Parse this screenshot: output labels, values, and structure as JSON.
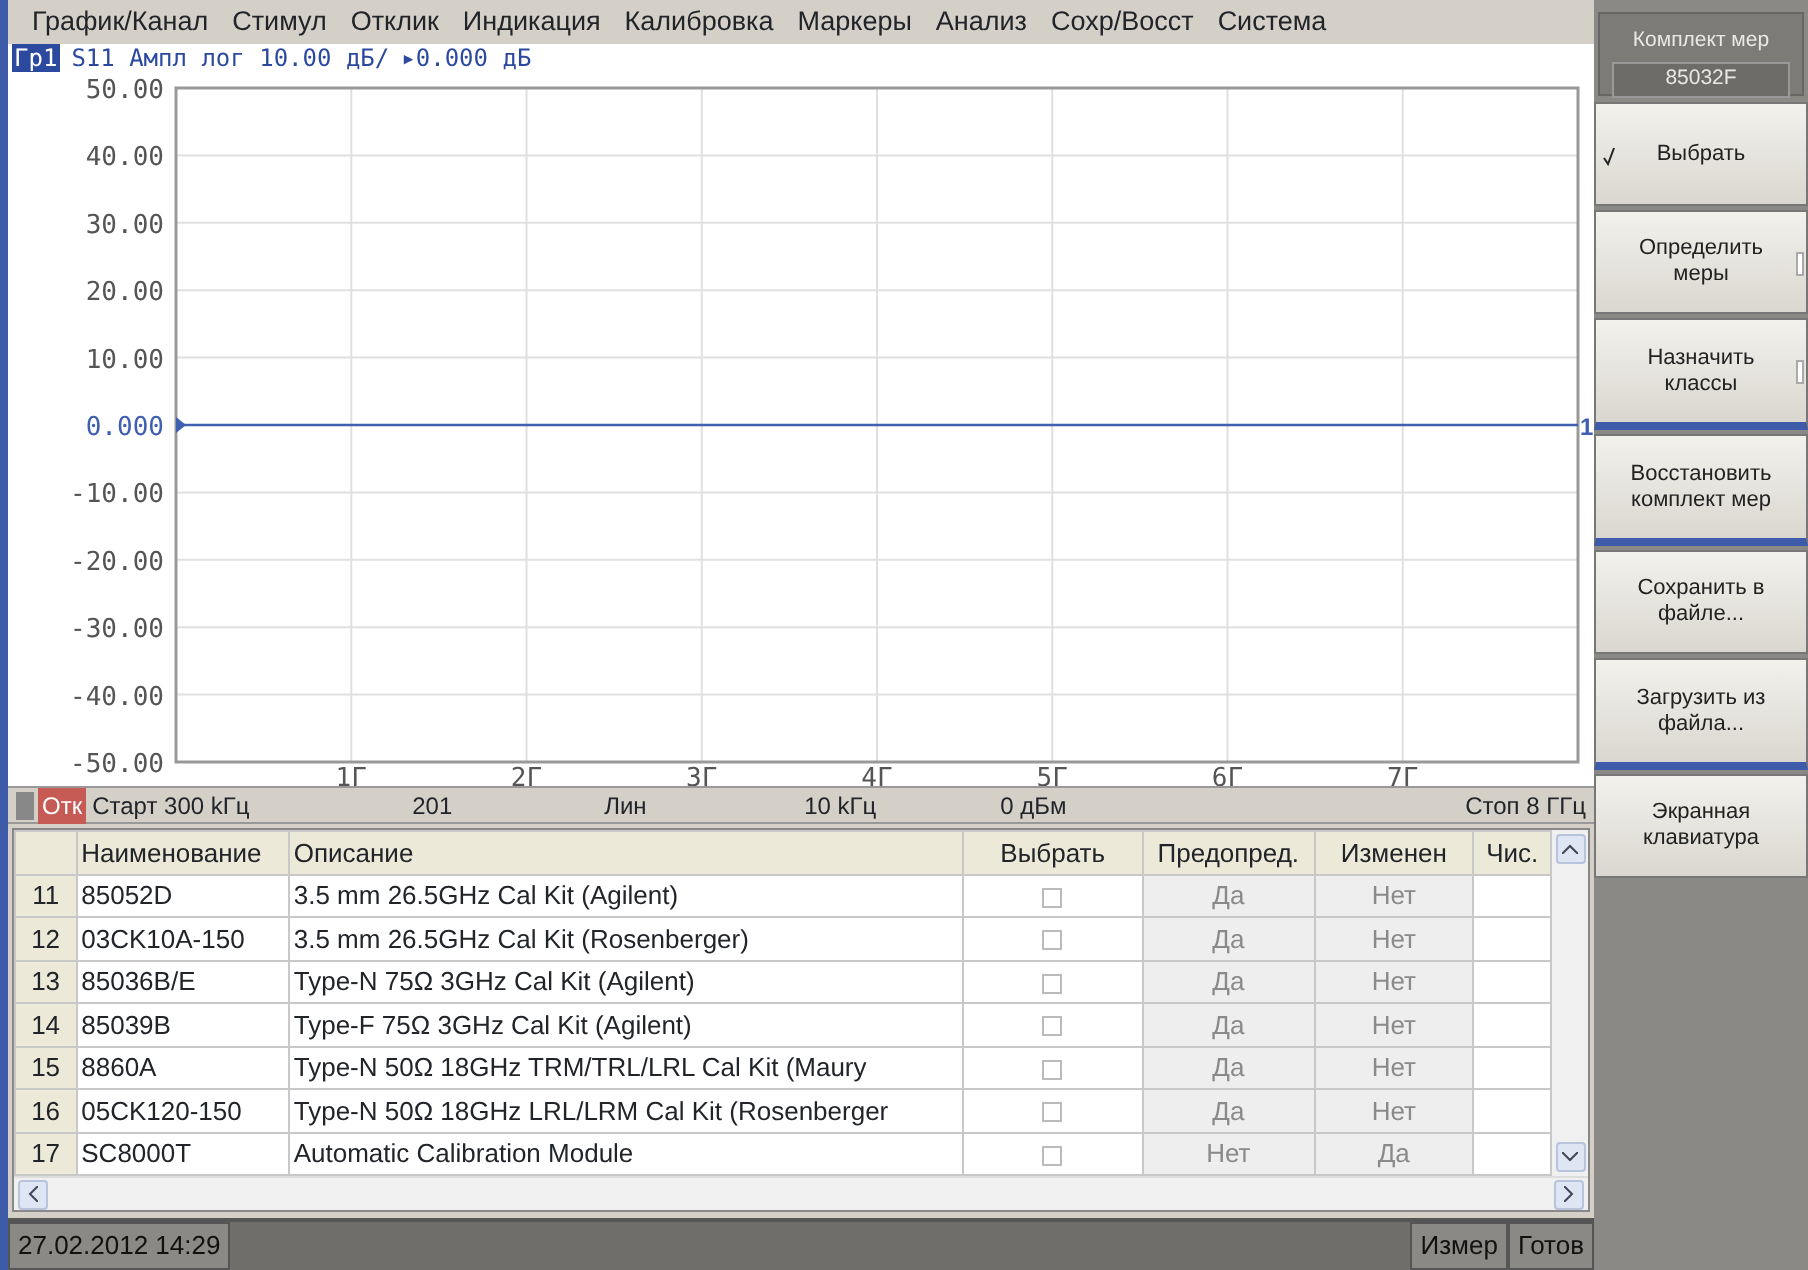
{
  "menu": [
    {
      "label": "График/Канал"
    },
    {
      "label": "Стимул"
    },
    {
      "label": "Отклик"
    },
    {
      "label": "Индикация"
    },
    {
      "label": "Калибровка"
    },
    {
      "label": "Маркеры"
    },
    {
      "label": "Анализ"
    },
    {
      "label": "Сохр/Восст"
    },
    {
      "label": "Система"
    }
  ],
  "trace": {
    "tag": "Гр1",
    "text": "S11 Ампл лог 10.00 дБ/",
    "reference": "▸0.000 дБ",
    "end_label": "1",
    "chart_data": {
      "type": "line",
      "x": [
        0,
        8
      ],
      "grid": true,
      "series": [
        {
          "color": "#3f5fb0",
          "values": [
            0,
            0
          ]
        }
      ],
      "xlim": [
        0,
        8
      ],
      "ylim": [
        -50,
        50
      ],
      "xticks": [
        {
          "value": 1,
          "label": "1Г"
        },
        {
          "value": 2,
          "label": "2Г"
        },
        {
          "value": 3,
          "label": "3Г"
        },
        {
          "value": 4,
          "label": "4Г"
        },
        {
          "value": 5,
          "label": "5Г"
        },
        {
          "value": 6,
          "label": "6Г"
        },
        {
          "value": 7,
          "label": "7Г"
        }
      ],
      "yticks": [
        {
          "value": 50,
          "label": "50.00"
        },
        {
          "value": 40,
          "label": "40.00"
        },
        {
          "value": 30,
          "label": "30.00"
        },
        {
          "value": 20,
          "label": "20.00"
        },
        {
          "value": 10,
          "label": "10.00"
        },
        {
          "value": 0,
          "label": "0.000"
        },
        {
          "value": -10,
          "label": "-10.00"
        },
        {
          "value": -20,
          "label": "-20.00"
        },
        {
          "value": -30,
          "label": "-30.00"
        },
        {
          "value": -40,
          "label": "-40.00"
        },
        {
          "value": -50,
          "label": "-50.00"
        }
      ]
    }
  },
  "channel_bar": {
    "state": "Отк",
    "start": "Старт 300 kГц",
    "points": "201",
    "sweep": "Лин",
    "ifbw": "10 kГц",
    "power": "0 дБм",
    "stop": "Стоп 8 ГГц"
  },
  "table": {
    "columns": [
      "",
      "Наименование",
      "Описание",
      "Выбрать",
      "Предопред.",
      "Изменен",
      "Чис."
    ],
    "rows": [
      {
        "number": "11",
        "name": "85052D",
        "description": "3.5 mm 26.5GHz Cal Kit (Agilent)",
        "checked": false,
        "predefined": "Да",
        "changed": "Нет"
      },
      {
        "number": "12",
        "name": "03CK10A-150",
        "description": "3.5 mm 26.5GHz Cal Kit (Rosenberger)",
        "checked": false,
        "predefined": "Да",
        "changed": "Нет"
      },
      {
        "number": "13",
        "name": "85036B/E",
        "description": "Type-N 75Ω 3GHz Cal Kit (Agilent)",
        "checked": false,
        "predefined": "Да",
        "changed": "Нет"
      },
      {
        "number": "14",
        "name": "85039B",
        "description": "Type-F 75Ω 3GHz Cal Kit (Agilent)",
        "checked": false,
        "predefined": "Да",
        "changed": "Нет"
      },
      {
        "number": "15",
        "name": "8860A",
        "description": "Type-N 50Ω 18GHz TRM/TRL/LRL Cal Kit  (Maury",
        "checked": false,
        "predefined": "Да",
        "changed": "Нет"
      },
      {
        "number": "16",
        "name": "05CK120-150",
        "description": "Type-N 50Ω 18GHz LRL/LRM Cal Kit (Rosenberger",
        "checked": false,
        "predefined": "Да",
        "changed": "Нет"
      },
      {
        "number": "17",
        "name": "SC8000T",
        "description": "Automatic Calibration Module",
        "checked": false,
        "predefined": "Нет",
        "changed": "Да"
      }
    ]
  },
  "status_bar": {
    "datetime": "27.02.2012 14:29",
    "mode": "Измер",
    "state": "Готов"
  },
  "softkeys": {
    "title": "Комплект мер",
    "value": "85032F",
    "buttons": [
      {
        "label": "Выбрать",
        "checked": true,
        "submenu": false,
        "separator_after": false
      },
      {
        "label": "Определить меры",
        "checked": false,
        "submenu": true,
        "separator_after": false
      },
      {
        "label": "Назначить классы",
        "checked": false,
        "submenu": true,
        "separator_after": true
      },
      {
        "label": "Восстановить комплект мер",
        "checked": false,
        "submenu": false,
        "separator_after": true
      },
      {
        "label": "Сохранить в файле...",
        "checked": false,
        "submenu": false,
        "separator_after": false
      },
      {
        "label": "Загрузить из файла...",
        "checked": false,
        "submenu": false,
        "separator_after": true
      },
      {
        "label": "Экранная клавиатура",
        "checked": false,
        "submenu": false,
        "separator_after": false
      }
    ]
  }
}
